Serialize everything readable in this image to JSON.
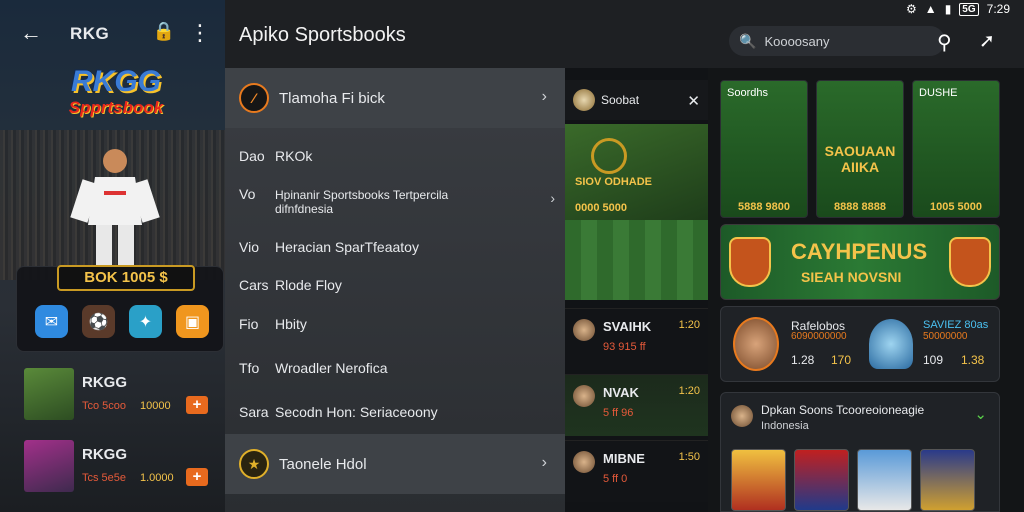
{
  "left_panel": {
    "title": "RKG",
    "logo_line1": "RKGG",
    "logo_line2": "Spprtsbook",
    "promo_label": "BOK 1005 $",
    "games": [
      {
        "name": "RKGG",
        "sub": "Tco 5coo",
        "value": "10000",
        "plus": "+"
      },
      {
        "name": "RKGG",
        "sub": "Tcs 5e5e",
        "value": "1.0000",
        "plus": "+"
      }
    ]
  },
  "status_bar": {
    "battery": "5G",
    "time": "7:29"
  },
  "header": {
    "title": "Apiko Sportsbooks",
    "search_value": "Koooosany"
  },
  "nav": {
    "section1": "Tlamoha Fi bick",
    "items": [
      {
        "code": "Dao",
        "label": "RKOk"
      },
      {
        "code": "Vo",
        "label": "Hpinanir Sportsbooks Tertpercila",
        "label2": "difnfdnesia"
      },
      {
        "code": "Vio",
        "label": "Heracian SparTfeaatoy"
      },
      {
        "code": "Cars",
        "label": "Rlode Floy"
      },
      {
        "code": "Fio",
        "label": "Hbity"
      },
      {
        "code": "Tfo",
        "label": "Wroadler Nerofica"
      },
      {
        "code": "Sara",
        "label": "Secodn Hon: Seriaceoony"
      }
    ],
    "section2": "Taonele Hdol"
  },
  "events": {
    "head": "Soobat",
    "banner_line1": "SIOV ODHADE",
    "banner_line2": "0000 5000",
    "cards": [
      {
        "team": "SVAIHK",
        "odds": "1:20",
        "score": "93 915 ff"
      },
      {
        "team": "NVAK",
        "odds": "1:20",
        "score": "5 ff 96"
      },
      {
        "team": "MIBNE",
        "odds": "1:50",
        "score": "5 ff 0"
      }
    ]
  },
  "grid": {
    "tiles": [
      {
        "title": "Soordhs",
        "bottom": "5888 9800"
      },
      {
        "title": "",
        "big": "SAOUAAN AIIKA",
        "bottom": "8888 8888"
      },
      {
        "title": "DUSHE",
        "bottom": "1005 5000"
      }
    ],
    "banner_line1": "CAYHPENUS",
    "banner_line2": "SIEAH NOVSNI",
    "odds": {
      "name1": "Rafelobos",
      "sub1": "6090000000",
      "odd1a": "1.28",
      "odd1b": "170",
      "name2": "SAVIEZ 80as",
      "sub2": "50000000",
      "odd2a": "109",
      "odd2b": "1.38"
    },
    "promo_title": "Dpkan Soons Tcooreoioneagie",
    "promo_sub": "Indonesia"
  }
}
